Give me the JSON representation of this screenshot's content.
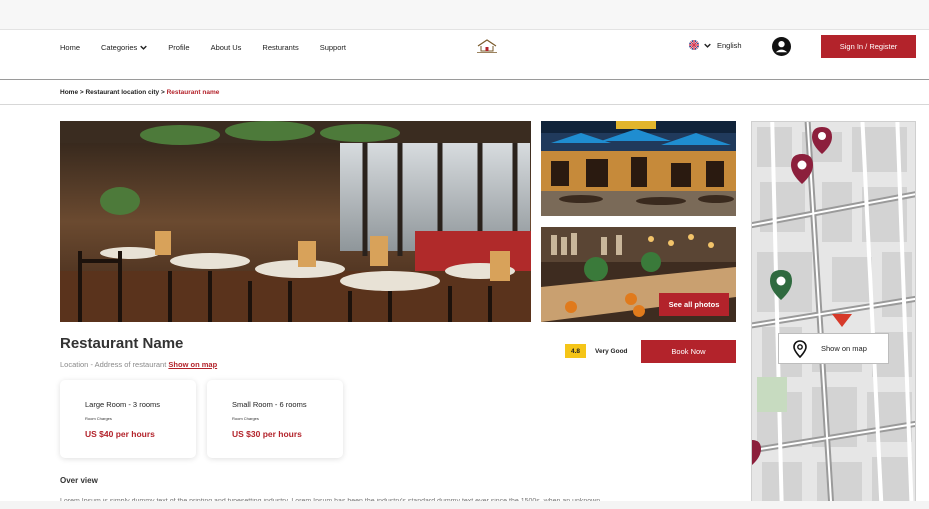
{
  "nav": {
    "links": [
      "Home",
      "Categories",
      "Profile",
      "About Us",
      "Resturants",
      "Support"
    ],
    "language": "English",
    "signin_label": "Sign In / Register"
  },
  "breadcrumb": {
    "home": "Home",
    "sep1": ">",
    "city": "Restaurant location city",
    "sep2": ">",
    "current": "Restaurant name"
  },
  "gallery": {
    "see_all_label": "See all photos"
  },
  "map": {
    "show_on_map_label": "Show on map"
  },
  "restaurant": {
    "name": "Restaurant Name",
    "location_text": "Location - Address of restaurant",
    "show_on_map_link": "Show on map",
    "rating": "4.8",
    "rating_text": "Very Good",
    "book_label": "Book Now"
  },
  "rooms": [
    {
      "name": "Large Room - 3 rooms",
      "sub": "Room Charges",
      "price": "US $40 per hours"
    },
    {
      "name": "Small Room - 6 rooms",
      "sub": "Room Charges",
      "price": "US $30 per hours"
    }
  ],
  "overview": {
    "title": "Over view",
    "text": "Lorem Ipsum is simply dummy text of the printing and typesetting industry. Lorem Ipsum has been the industry's standard dummy text ever since the 1500s, when an unknown"
  },
  "colors": {
    "brand": "#b3232b",
    "rating_badge": "#f5c518"
  },
  "icons": [
    "chevron-down-icon",
    "house-logo-icon",
    "uk-flag-icon",
    "user-avatar-icon",
    "map-pin-icon"
  ]
}
